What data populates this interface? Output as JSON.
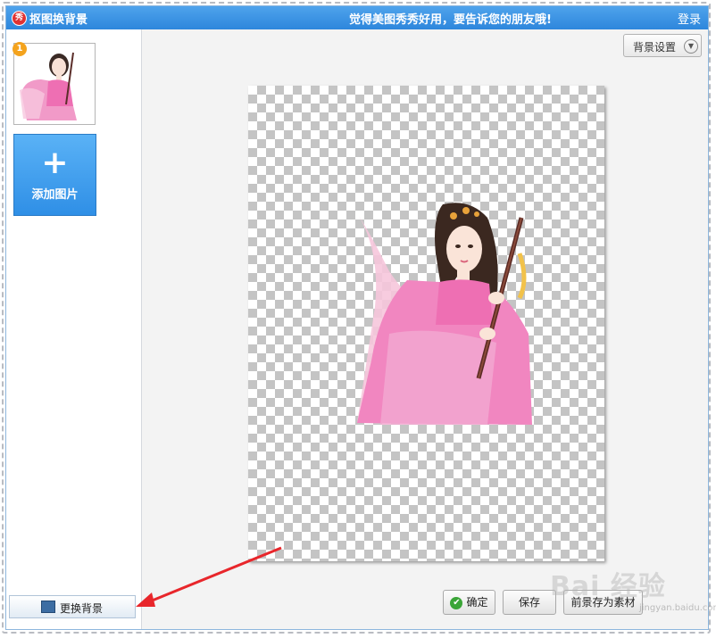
{
  "window": {
    "title": "抠图换背景",
    "slogan": "觉得美图秀秀好用，要告诉您的朋友哦!",
    "login_label": "登录",
    "app_icon_text": "秀"
  },
  "sidebar": {
    "thumbnail_badge": "1",
    "add_image_label": "添加图片",
    "add_image_plus": "+",
    "change_background_label": "更换背景"
  },
  "toolbar": {
    "background_settings_label": "背景设置"
  },
  "actions": {
    "confirm_label": "确定",
    "save_label": "保存",
    "save_foreground_label": "前景存为素材"
  },
  "watermark": {
    "text": "Bai 经验",
    "sub": "jingyan.baidu.com"
  },
  "colors": {
    "titlebar": "#2d86dc",
    "accent_blue": "#3a95e8",
    "annotation_arrow": "#e8262b",
    "confirm_check": "#3aa537"
  }
}
